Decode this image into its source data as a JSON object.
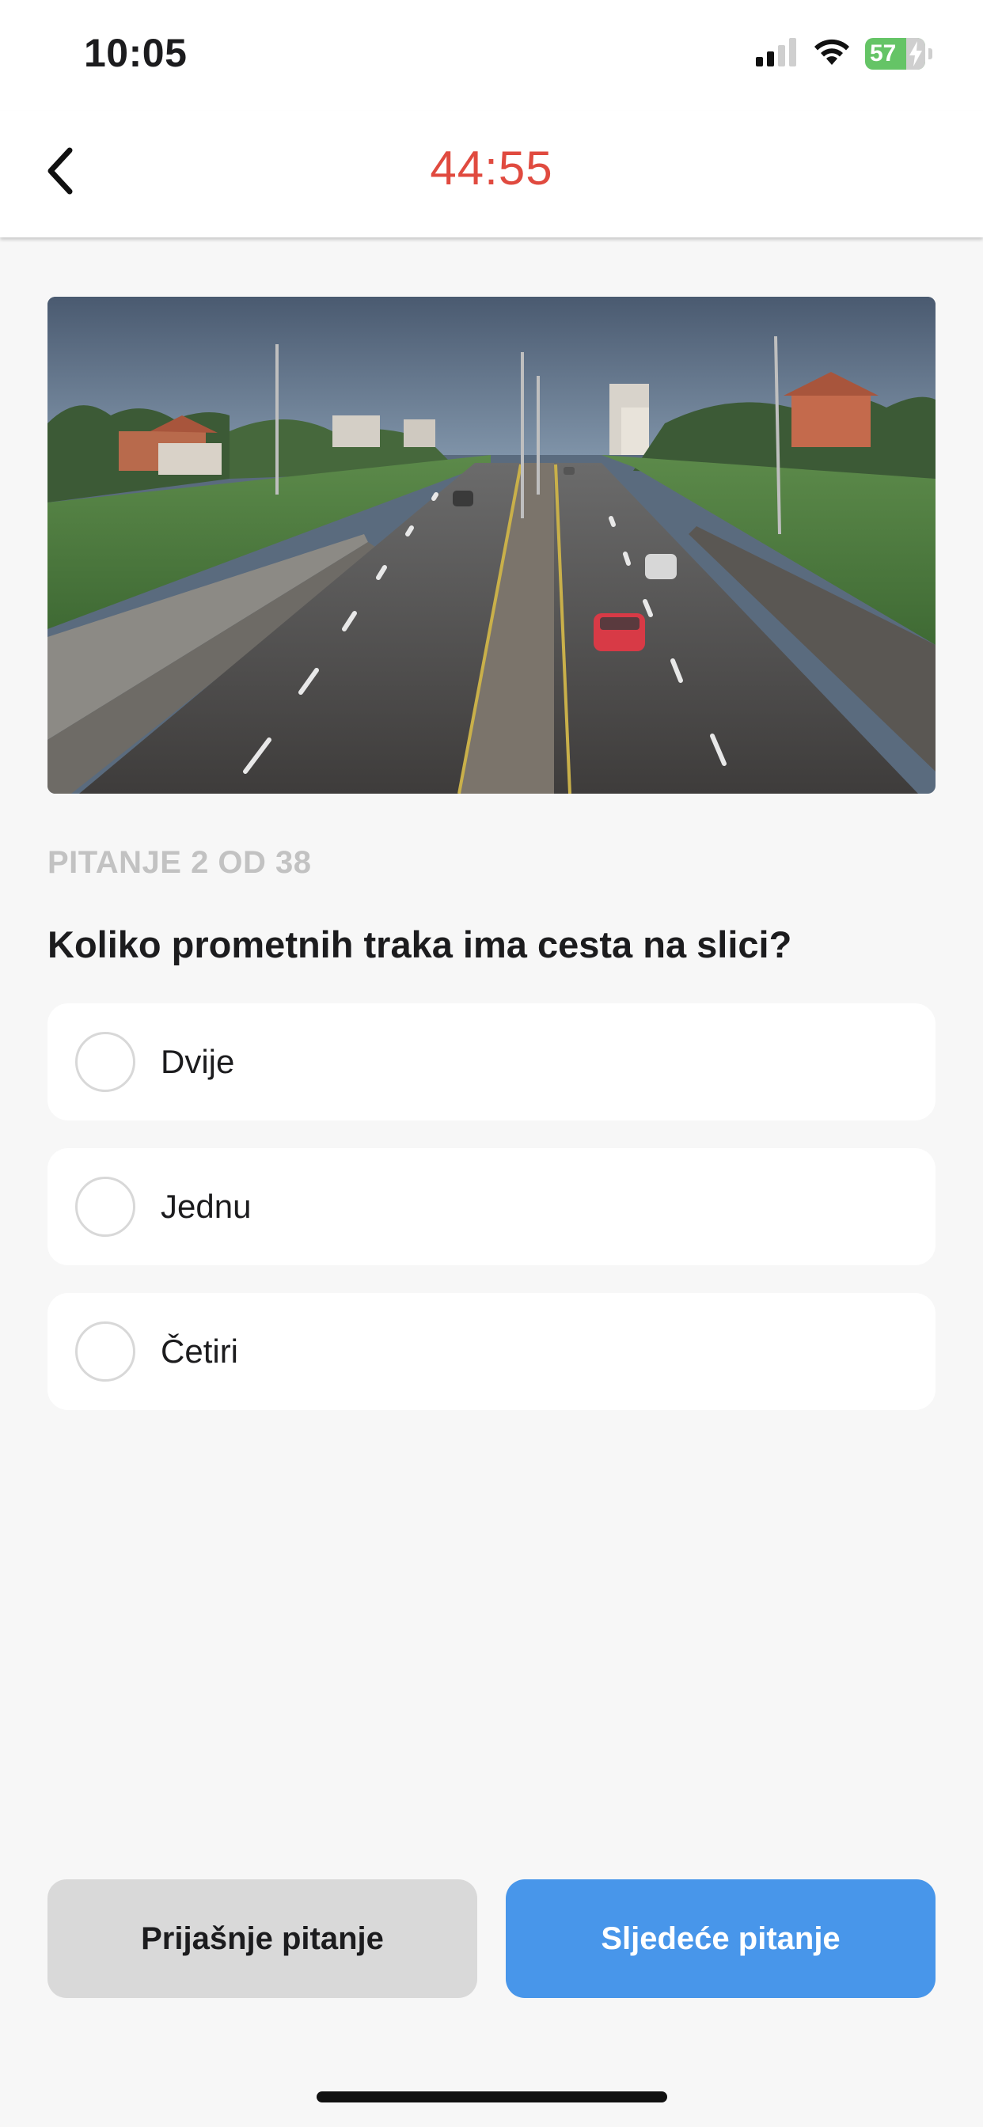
{
  "status_bar": {
    "time": "10:05",
    "battery_level": "57",
    "icons": [
      "cellular-signal-icon",
      "wifi-icon",
      "battery-charging-icon"
    ]
  },
  "header": {
    "back_icon": "chevron-left-icon",
    "timer": "44:55",
    "timer_color": "#e04a3f"
  },
  "question": {
    "counter": "PITANJE 2 OD 38",
    "text": "Koliko prometnih traka ima cesta na slici?",
    "image_alt": "road-photo",
    "answers": [
      {
        "label": "Dvije"
      },
      {
        "label": "Jednu"
      },
      {
        "label": "Četiri"
      }
    ]
  },
  "navigation": {
    "prev_label": "Prijašnje pitanje",
    "next_label": "Sljedeće pitanje",
    "next_color": "#4896ea",
    "prev_color": "#d9d9d9"
  }
}
